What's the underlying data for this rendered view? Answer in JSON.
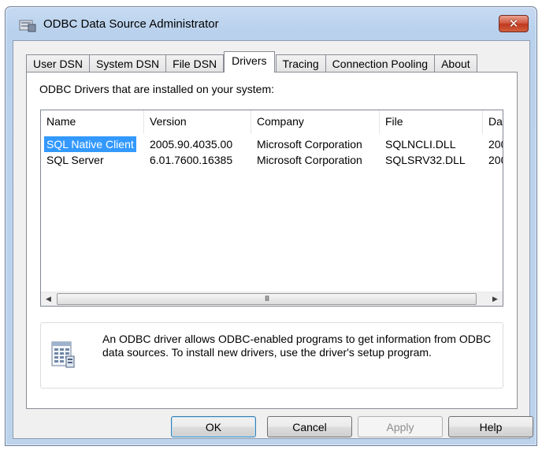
{
  "window": {
    "title": "ODBC Data Source Administrator",
    "close_label": "✕"
  },
  "tabs": [
    {
      "label": "User DSN"
    },
    {
      "label": "System DSN"
    },
    {
      "label": "File DSN"
    },
    {
      "label": "Drivers"
    },
    {
      "label": "Tracing"
    },
    {
      "label": "Connection Pooling"
    },
    {
      "label": "About"
    }
  ],
  "active_tab": "Drivers",
  "drivers": {
    "prompt": "ODBC Drivers that are installed on your system:",
    "columns": [
      "Name",
      "Version",
      "Company",
      "File",
      "Dat"
    ],
    "rows": [
      [
        "SQL Native Client",
        "2005.90.4035.00",
        "Microsoft Corporation",
        "SQLNCLI.DLL",
        "200"
      ],
      [
        "SQL Server",
        "6.01.7600.16385",
        "Microsoft Corporation",
        "SQLSRV32.DLL",
        "200"
      ]
    ],
    "selected_row": 0,
    "scroll": {
      "left_arrow": "◀",
      "right_arrow": "▶",
      "thumb_grip": "III"
    }
  },
  "info": {
    "text": "An ODBC driver allows ODBC-enabled programs to get information from ODBC data sources.  To install new drivers, use the driver's setup program."
  },
  "buttons": {
    "ok": "OK",
    "cancel": "Cancel",
    "apply": "Apply",
    "help": "Help"
  },
  "colors": {
    "selection": "#3399ff",
    "close_button": "#c7432a",
    "title_bar": "#bcd2ec"
  }
}
